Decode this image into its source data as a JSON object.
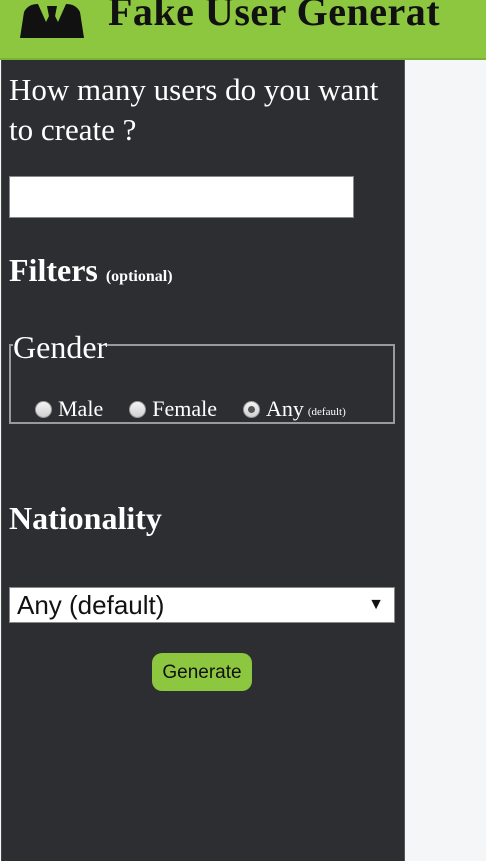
{
  "header": {
    "title": "Fake User Generat"
  },
  "form": {
    "question": "How many users do you want to create ?",
    "count_value": "",
    "filters_label": "Filters",
    "filters_note": "(optional)",
    "gender": {
      "legend": "Gender",
      "options": [
        {
          "label": "Male",
          "checked": false
        },
        {
          "label": "Female",
          "checked": false
        },
        {
          "label": "Any",
          "checked": true,
          "note": "(default)"
        }
      ]
    },
    "nationality_label": "Nationality",
    "nationality_selected": "Any (default)",
    "generate_label": "Generate"
  },
  "colors": {
    "brand_green": "#8dc63f",
    "sidebar_bg": "#2c2e31",
    "page_bg": "#f5f6f8"
  },
  "icons": {
    "logo": "users-icon",
    "select_arrow": "dropdown-arrow-icon"
  }
}
